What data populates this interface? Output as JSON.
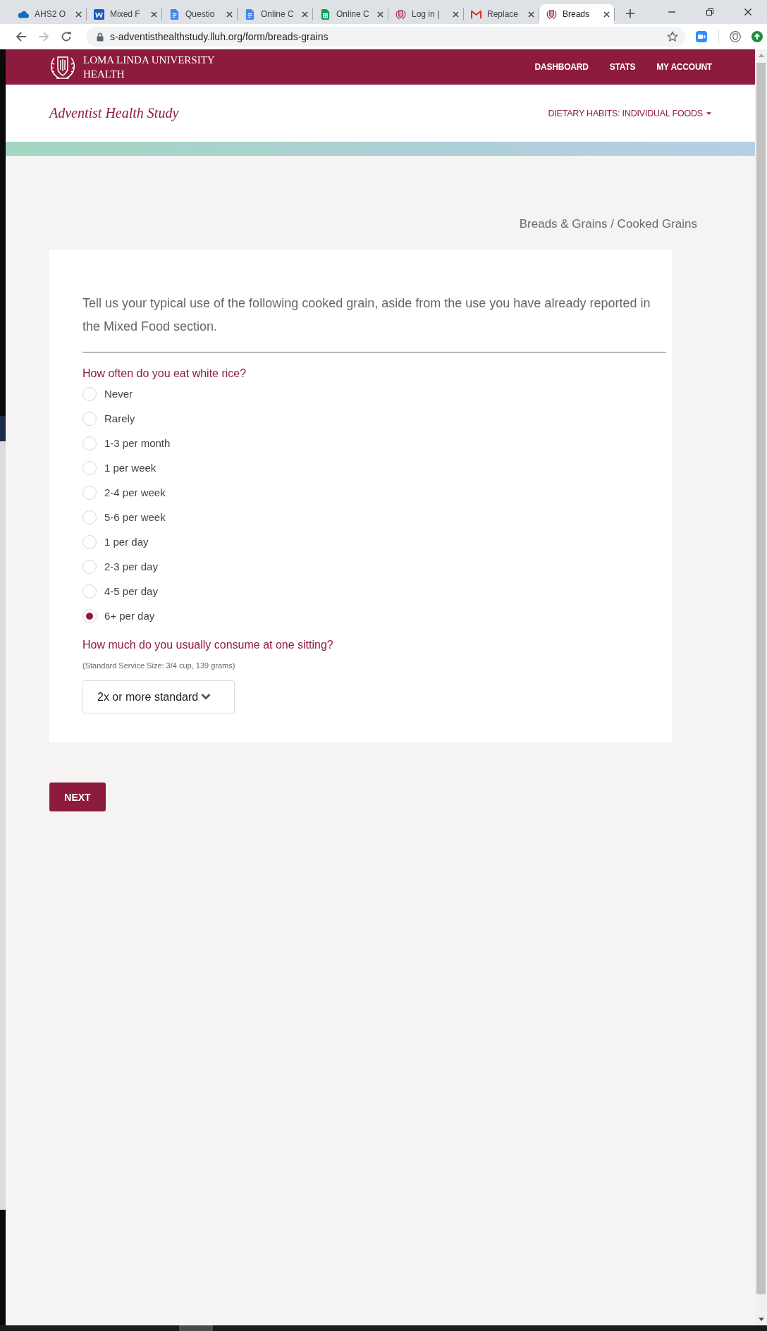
{
  "browser": {
    "tabs": [
      {
        "kind": "cloud",
        "title": "AHS2 O",
        "selected": false
      },
      {
        "kind": "word",
        "title": "Mixed F",
        "selected": false
      },
      {
        "kind": "docs",
        "title": "Questio",
        "selected": false
      },
      {
        "kind": "docs",
        "title": "Online C",
        "selected": false
      },
      {
        "kind": "sheets",
        "title": "Online C",
        "selected": false
      },
      {
        "kind": "crest",
        "title": "Log in |",
        "selected": false
      },
      {
        "kind": "mail",
        "title": "Replace",
        "selected": false
      },
      {
        "kind": "crest",
        "title": "Breads",
        "selected": true
      }
    ],
    "url": "s-adventisthealthstudy.lluh.org/form/breads-grains"
  },
  "header": {
    "brand": "LOMA LINDA UNIVERSITY HEALTH",
    "nav": [
      "DASHBOARD",
      "STATS",
      "MY ACCOUNT"
    ]
  },
  "subheader": {
    "study_title": "Adventist Health Study",
    "section_menu": "DIETARY HABITS: INDIVIDUAL FOODS"
  },
  "breadcrumb": "Breads & Grains / Cooked Grains",
  "form": {
    "intro": "Tell us your typical use of the following cooked grain, aside from the use you have already reported in the Mixed Food section.",
    "questions": [
      {
        "kind": "radio",
        "prompt": "How often do you eat white rice?",
        "options": [
          {
            "label": "Never",
            "selected": false
          },
          {
            "label": "Rarely",
            "selected": false
          },
          {
            "label": "1-3 per month",
            "selected": false
          },
          {
            "label": "1 per week",
            "selected": false
          },
          {
            "label": "2-4 per week",
            "selected": false
          },
          {
            "label": "5-6 per week",
            "selected": false
          },
          {
            "label": "1 per day",
            "selected": false
          },
          {
            "label": "2-3 per day",
            "selected": false
          },
          {
            "label": "4-5 per day",
            "selected": false
          },
          {
            "label": "6+ per day",
            "selected": true
          }
        ]
      },
      {
        "kind": "select",
        "prompt": "How much do you usually consume at one sitting?",
        "note": "(Standard Service Size: 3/4 cup, 139 grams)",
        "value": "2x or more standard"
      }
    ]
  },
  "next_button": "NEXT"
}
